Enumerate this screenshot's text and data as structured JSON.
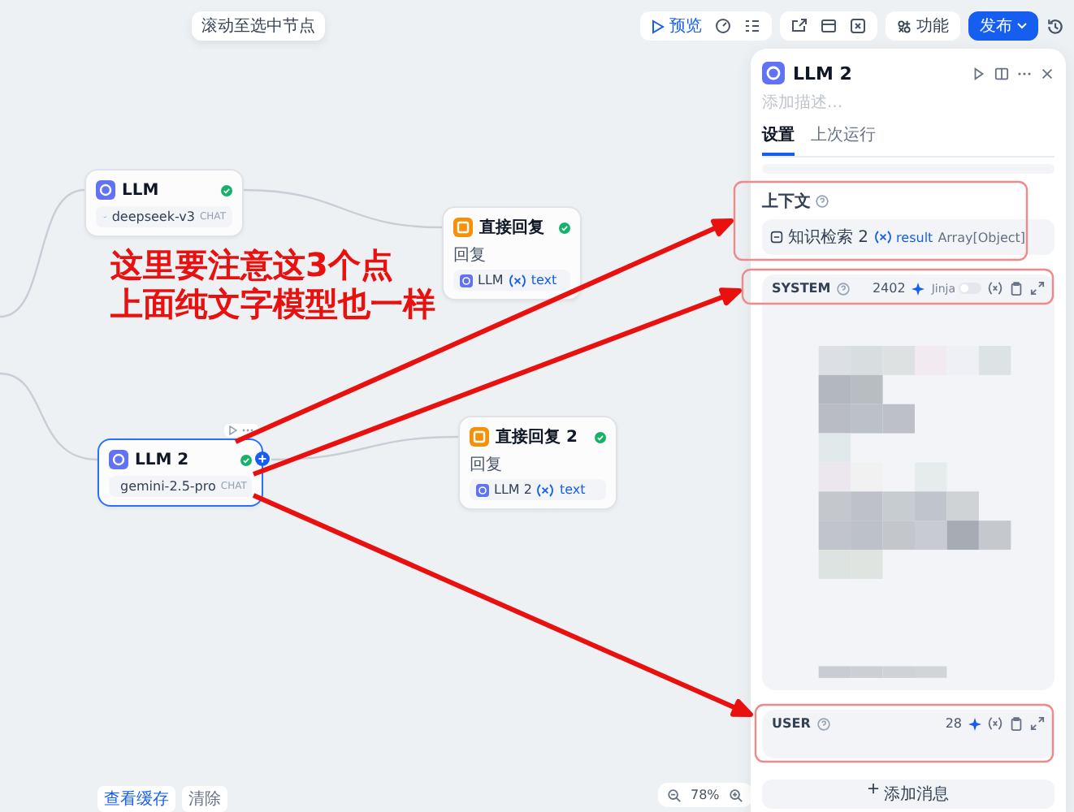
{
  "toolbar": {
    "tooltip": "滚动至选中节点",
    "preview": "预览",
    "features": "功能",
    "publish": "发布"
  },
  "canvas": {
    "nodes": [
      {
        "kind": "llm",
        "title": "LLM",
        "model": "deepseek-v3",
        "mode": "CHAT",
        "selected": false
      },
      {
        "kind": "answer",
        "title": "直接回复",
        "field_label": "回复",
        "source": "LLM",
        "variable": "text",
        "selected": false
      },
      {
        "kind": "llm",
        "title": "LLM 2",
        "model": "gemini-2.5-pro",
        "mode": "CHAT",
        "selected": true
      },
      {
        "kind": "answer",
        "title": "直接回复 2",
        "field_label": "回复",
        "source": "LLM 2",
        "variable": "text",
        "selected": false
      }
    ]
  },
  "annotation": {
    "lines": [
      "这里要注意这3个点",
      "上面纯文字模型也一样"
    ]
  },
  "footer": {
    "view_cache": "查看缓存",
    "clear": "清除",
    "zoom": "78%"
  },
  "panel": {
    "title": "LLM 2",
    "description_placeholder": "添加描述...",
    "tabs": [
      {
        "label": "设置",
        "selected": true
      },
      {
        "label": "上次运行",
        "selected": false
      }
    ],
    "context": {
      "label": "上下文",
      "node": "知识检索 2",
      "variable": "result",
      "type": "Array[Object]"
    },
    "messages": [
      {
        "role": "SYSTEM",
        "count": "2402",
        "jinja": {
          "label": "Jinja",
          "on": false
        }
      },
      {
        "role": "USER",
        "count": "28"
      }
    ],
    "add_message": "添加消息"
  }
}
